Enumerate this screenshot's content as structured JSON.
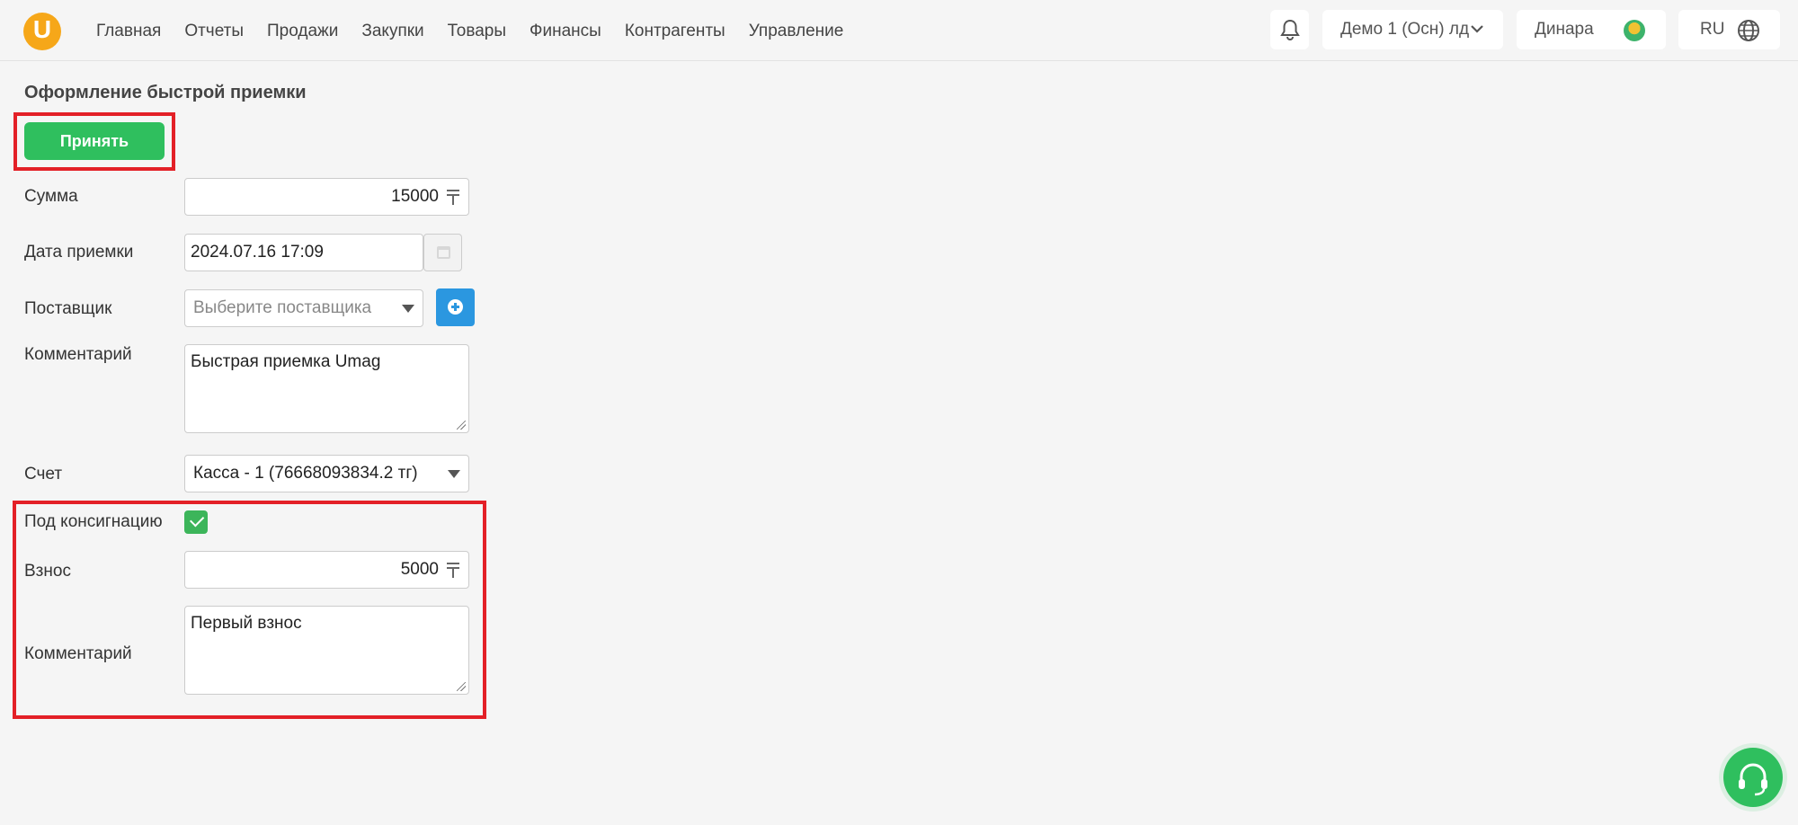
{
  "nav": {
    "logo_letter": "U",
    "items": [
      "Главная",
      "Отчеты",
      "Продажи",
      "Закупки",
      "Товары",
      "Финансы",
      "Контрагенты",
      "Управление"
    ],
    "company": "Демо 1 (Осн) лд",
    "user": "Динара",
    "language": "RU"
  },
  "page": {
    "title": "Оформление быстрой приемки",
    "accept_label": "Принять"
  },
  "form": {
    "sum_label": "Сумма",
    "sum_value": "15000",
    "date_label": "Дата приемки",
    "date_value": "2024.07.16 17:09",
    "supplier_label": "Поставщик",
    "supplier_placeholder": "Выберите поставщика",
    "comment_label": "Комментарий",
    "comment_value": "Быстрая приемка Umag",
    "account_label": "Счет",
    "account_value": "Касса - 1 (76668093834.2 тг)",
    "consignment_label": "Под консигнацию",
    "consignment_checked": true,
    "deposit_label": "Взнос",
    "deposit_value": "5000",
    "deposit_comment_label": "Комментарий",
    "deposit_comment_value": "Первый взнос"
  },
  "colors": {
    "accent_green": "#2fbf5e",
    "highlight_red": "#e32027",
    "add_blue": "#2b97e0",
    "logo_orange": "#f6a719"
  },
  "icons": [
    "bell-icon",
    "chevron-down-icon",
    "globe-icon",
    "tenge-icon",
    "calendar-icon",
    "plus-circle-icon",
    "headset-icon"
  ]
}
